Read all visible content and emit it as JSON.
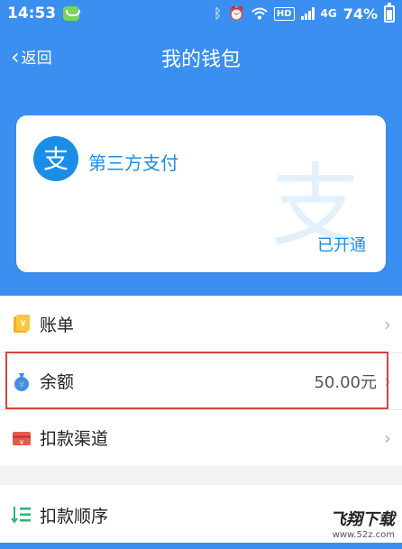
{
  "status_bar": {
    "time": "14:53",
    "hd": "HD",
    "network": "4G",
    "battery": "74%"
  },
  "header": {
    "back_label": "返回",
    "title": "我的钱包"
  },
  "card": {
    "brand": "第三方支付",
    "logo_glyph": "支",
    "status": "已开通"
  },
  "menu": {
    "items": [
      {
        "label": "账单",
        "icon": "bill-icon"
      },
      {
        "label": "余额",
        "value": "50.00元",
        "icon": "money-bag-icon"
      },
      {
        "label": "扣款渠道",
        "icon": "payment-channel-icon"
      }
    ],
    "order": {
      "label": "扣款顺序",
      "icon": "payment-order-icon"
    }
  },
  "watermark": {
    "title": "飞翔下载",
    "site": "www.52z.com"
  },
  "colors": {
    "primary": "#3b8ff0",
    "alipay_blue": "#1a8ee6",
    "highlight": "#d9443c",
    "bill_icon": "#f5b21b",
    "channel_icon": "#e9584a",
    "order_icon": "#2bb673"
  }
}
